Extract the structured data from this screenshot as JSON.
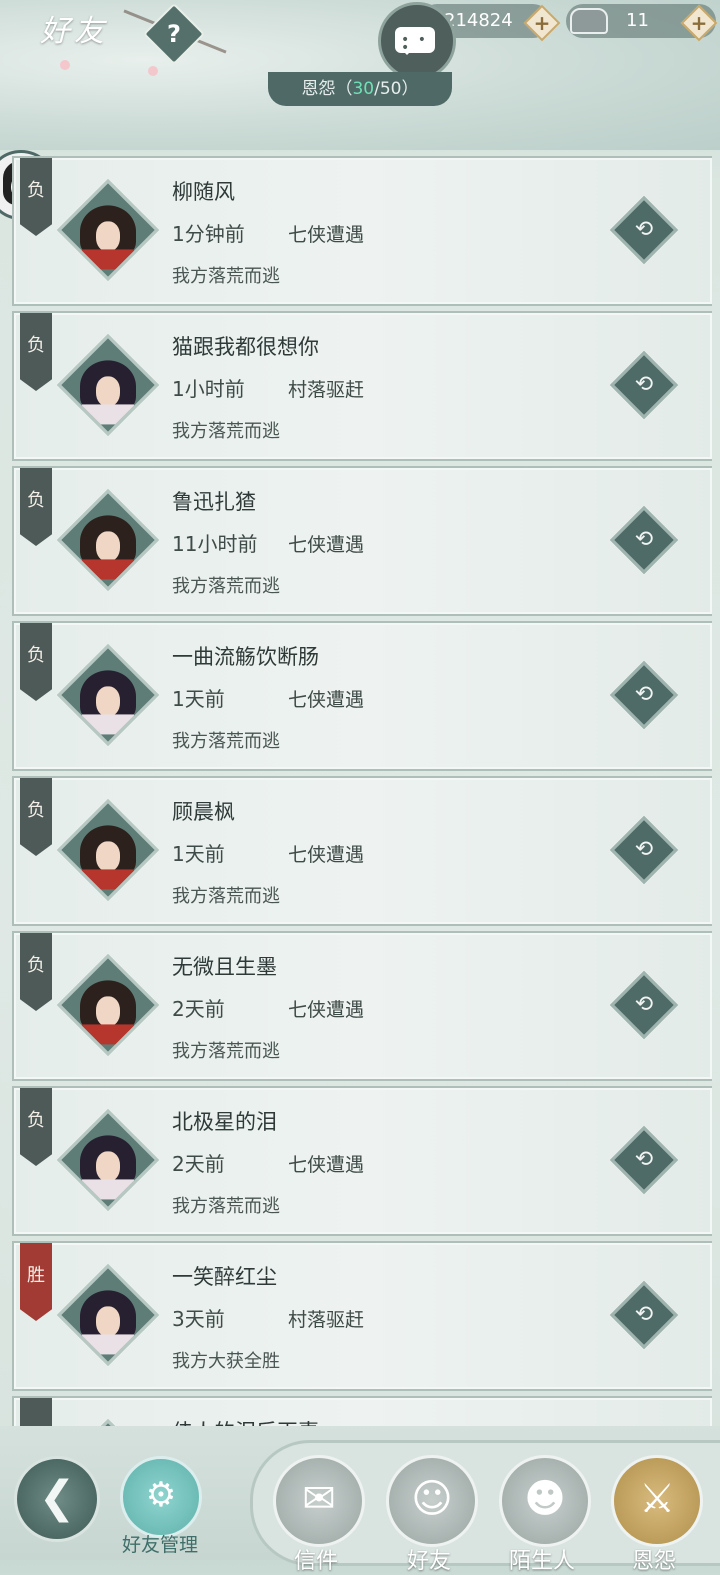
{
  "header": {
    "title": "好友",
    "help_symbol": "?",
    "copper": "214824",
    "silver": "11",
    "plus": "+",
    "feud_tab": {
      "label": "恩怨",
      "open": "（",
      "current": "30",
      "sep": "/",
      "max": "50",
      "close": "）"
    }
  },
  "entries": [
    {
      "tag": "负",
      "name": "柳随风",
      "time": "1分钟前",
      "event": "七侠遭遇",
      "result": "我方落荒而逃",
      "avatar": "male"
    },
    {
      "tag": "负",
      "name": "猫跟我都很想你",
      "time": "1小时前",
      "event": "村落驱赶",
      "result": "我方落荒而逃",
      "avatar": "female"
    },
    {
      "tag": "负",
      "name": "鲁迅扎猹",
      "time": "11小时前",
      "event": "七侠遭遇",
      "result": "我方落荒而逃",
      "avatar": "male"
    },
    {
      "tag": "负",
      "name": "一曲流觞饮断肠",
      "time": "1天前",
      "event": "七侠遭遇",
      "result": "我方落荒而逃",
      "avatar": "female"
    },
    {
      "tag": "负",
      "name": "顾晨枫",
      "time": "1天前",
      "event": "七侠遭遇",
      "result": "我方落荒而逃",
      "avatar": "male"
    },
    {
      "tag": "负",
      "name": "无微且生墨",
      "time": "2天前",
      "event": "七侠遭遇",
      "result": "我方落荒而逃",
      "avatar": "male"
    },
    {
      "tag": "负",
      "name": "北极星的泪",
      "time": "2天前",
      "event": "七侠遭遇",
      "result": "我方落荒而逃",
      "avatar": "female"
    },
    {
      "tag": "胜",
      "name": "一笑醉红尘",
      "time": "3天前",
      "event": "村落驱赶",
      "result": "我方大获全胜",
      "avatar": "female"
    },
    {
      "tag": "",
      "name": "佳人的泪后再喜",
      "time": "",
      "event": "",
      "result": "",
      "avatar": "female"
    }
  ],
  "bottom": {
    "back_symbol": "❮",
    "friend_manage": "好友管理",
    "tabs": [
      "信件",
      "好友",
      "陌生人",
      "恩怨"
    ],
    "active_tab": "恩怨"
  },
  "colors": {
    "lose_tag": "#4d5a58",
    "win_tag": "#a23b34",
    "accent_green": "#6fe0b6"
  }
}
